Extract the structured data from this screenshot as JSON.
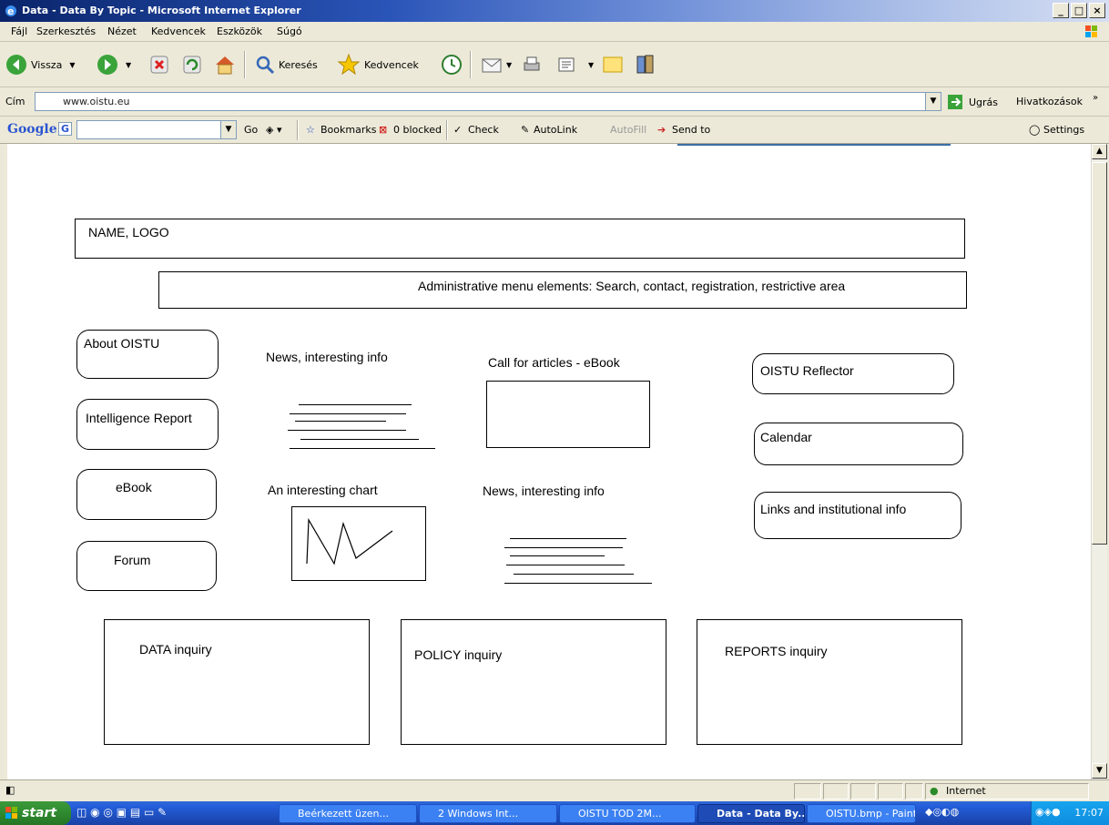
{
  "window": {
    "title": "Data - Data By Topic - Microsoft Internet Explorer",
    "controls": [
      "_",
      "□",
      "×"
    ]
  },
  "menu": [
    "Fájl",
    "Szerkesztés",
    "Nézet",
    "Kedvencek",
    "Eszközök",
    "Súgó"
  ],
  "toolbar": {
    "back_label": "Vissza",
    "search_label": "Keresés",
    "favorites_label": "Kedvencek"
  },
  "address": {
    "label": "Cím",
    "value": "www.oistu.eu",
    "go_label": "Ugrás",
    "links_label": "Hivatkozások"
  },
  "google": {
    "logo": "Google",
    "go_label": "Go",
    "bookmarks_label": "Bookmarks",
    "blocked_label": "0 blocked",
    "check_label": "Check",
    "autolink_label": "AutoLink",
    "autofill_label": "AutoFill",
    "sendto_label": "Send to",
    "settings_label": "Settings"
  },
  "page": {
    "header": "NAME, LOGO",
    "admin_menu": "Administrative menu elements: Search, contact, registration, restrictive area",
    "left_menu": [
      "About OISTU",
      "Intelligence Report",
      "eBook",
      "Forum"
    ],
    "center": {
      "news1": "News, interesting info",
      "call": "Call for articles - eBook",
      "chart": "An interesting chart",
      "news2": "News, interesting info"
    },
    "right_menu": [
      "OISTU Reflector",
      "Calendar",
      "Links and institutional info"
    ],
    "inquiries": [
      "DATA inquiry",
      "POLICY inquiry",
      "REPORTS inquiry"
    ]
  },
  "status": {
    "zone": "Internet"
  },
  "taskbar": {
    "start": "start",
    "tasks": [
      "Beérkezett üzen...",
      "2 Windows Int...",
      "OISTU TOD 2M...",
      "Data - Data By...",
      "OISTU.bmp - Paint"
    ],
    "clock": "17:07"
  }
}
